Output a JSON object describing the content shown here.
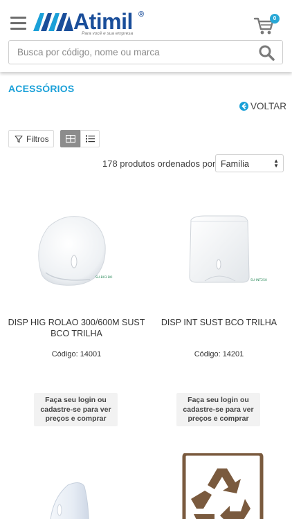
{
  "header": {
    "logo_text": "Atimil",
    "logo_reg": "®",
    "logo_tagline": "Para você e sua empresa",
    "cart_count": "0",
    "brand_color": "#1a4e9a",
    "accent_color": "#1aa0d8"
  },
  "search": {
    "placeholder": "Busca por código, nome ou marca",
    "value": ""
  },
  "category": {
    "title": "ACESSÓRIOS",
    "back_label": "VOLTAR"
  },
  "toolbar": {
    "filter_label": "Filtros",
    "view_mode": "grid",
    "count_text": "178 produtos ordenados por:",
    "sort_value": "Família"
  },
  "products": [
    {
      "name": "DISP HIG ROLAO 300/600M SUST BCO TRILHA",
      "code": "Código: 14001",
      "image_label": "SU-B03 BO",
      "login_text": "Faça seu login ou cadastre-se para ver preços e comprar"
    },
    {
      "name": "DISP INT SUST BCO TRILHA",
      "code": "Código: 14201",
      "image_label": "SU-INT250",
      "login_text": "Faça seu login ou cadastre-se para ver preços e comprar"
    },
    {
      "image": "dispenser-partial"
    },
    {
      "image": "recycle-symbol"
    }
  ]
}
